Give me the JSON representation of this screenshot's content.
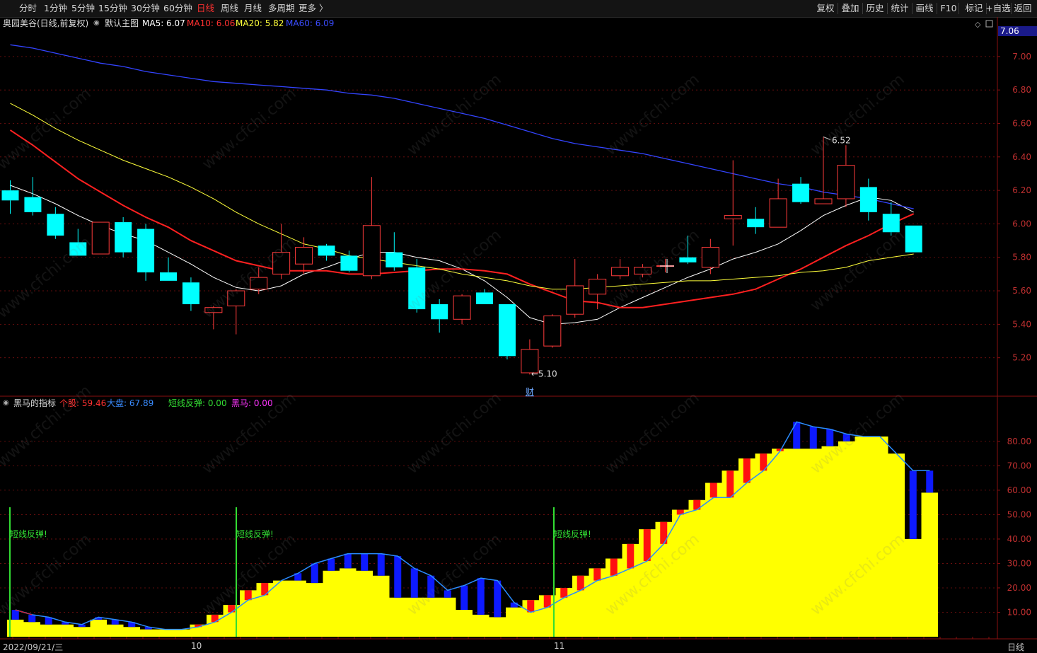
{
  "toolbar": {
    "periods": [
      {
        "label": "分时",
        "active": false
      },
      {
        "label": "1分钟",
        "active": false
      },
      {
        "label": "5分钟",
        "active": false
      },
      {
        "label": "15分钟",
        "active": false
      },
      {
        "label": "30分钟",
        "active": false
      },
      {
        "label": "60分钟",
        "active": false
      },
      {
        "label": "日线",
        "active": true
      },
      {
        "label": "周线",
        "active": false
      },
      {
        "label": "月线",
        "active": false
      },
      {
        "label": "多周期",
        "active": false
      },
      {
        "label": "更多 〉",
        "active": false
      }
    ],
    "actions": [
      "复权",
      "叠加",
      "历史",
      "统计",
      "画线",
      "F10",
      "标记",
      "+自选",
      "返回"
    ]
  },
  "main_header": {
    "stock": "奥园美谷(日线,前复权)",
    "template": "默认主图",
    "ma5": "MA5: 6.07",
    "ma10": "MA10: 6.06",
    "ma20": "MA20: 5.82",
    "ma60": "MA60: 6.09",
    "last_price": "7.06"
  },
  "sub_header": {
    "name": "黑马的指标",
    "individual": "个股: 59.46",
    "market": "大盘: 67.89",
    "rebound": "短线反弹: 0.00",
    "darkhorse": "黑马: 0.00"
  },
  "bottom_bar": {
    "dates": [
      "2022/09/21/三",
      "10",
      "11"
    ],
    "period": "日线"
  },
  "watermark": "www.cfchi.com",
  "colors": {
    "up": "#ff3b3b",
    "down": "#00ffff",
    "ma5": "#ffffff",
    "ma10": "#ff2020",
    "ma20": "#ffff3a",
    "ma60": "#3344ff",
    "grid": "#7a1010",
    "axis_text": "#c03030",
    "fill_yellow": "#ffff00",
    "bar_blue": "#0d1aff",
    "bar_red": "#ff1010",
    "rebound_green": "#33dd33",
    "line_blue": "#2a8cff"
  },
  "chart_data": [
    {
      "type": "candlestick",
      "title": "奥园美谷(日线,前复权)",
      "ylim": [
        5.0,
        7.16
      ],
      "y_ticks": [
        "7.00",
        "6.80",
        "6.60",
        "6.40",
        "6.20",
        "6.00",
        "5.80",
        "5.60",
        "5.40",
        "5.20"
      ],
      "annotations": [
        {
          "text": "6.52",
          "kind": "high",
          "index": 36
        },
        {
          "text": "5.10",
          "kind": "low",
          "index": 23
        },
        {
          "text": "财",
          "kind": "event",
          "index": 23
        }
      ],
      "candles": [
        {
          "o": 6.2,
          "h": 6.26,
          "l": 6.06,
          "c": 6.14
        },
        {
          "o": 6.16,
          "h": 6.28,
          "l": 6.05,
          "c": 6.07
        },
        {
          "o": 6.06,
          "h": 6.1,
          "l": 5.91,
          "c": 5.93
        },
        {
          "o": 5.89,
          "h": 5.97,
          "l": 5.81,
          "c": 5.81
        },
        {
          "o": 5.82,
          "h": 6.01,
          "l": 5.82,
          "c": 6.01
        },
        {
          "o": 6.01,
          "h": 6.04,
          "l": 5.8,
          "c": 5.83
        },
        {
          "o": 5.97,
          "h": 6.0,
          "l": 5.66,
          "c": 5.71
        },
        {
          "o": 5.71,
          "h": 5.8,
          "l": 5.66,
          "c": 5.66
        },
        {
          "o": 5.65,
          "h": 5.68,
          "l": 5.48,
          "c": 5.52
        },
        {
          "o": 5.47,
          "h": 5.51,
          "l": 5.37,
          "c": 5.5
        },
        {
          "o": 5.51,
          "h": 5.61,
          "l": 5.34,
          "c": 5.6
        },
        {
          "o": 5.61,
          "h": 5.74,
          "l": 5.58,
          "c": 5.68
        },
        {
          "o": 5.7,
          "h": 6.0,
          "l": 5.67,
          "c": 5.83
        },
        {
          "o": 5.76,
          "h": 5.92,
          "l": 5.7,
          "c": 5.86
        },
        {
          "o": 5.87,
          "h": 5.88,
          "l": 5.78,
          "c": 5.81
        },
        {
          "o": 5.81,
          "h": 5.84,
          "l": 5.71,
          "c": 5.72
        },
        {
          "o": 5.69,
          "h": 6.28,
          "l": 5.67,
          "c": 5.99
        },
        {
          "o": 5.83,
          "h": 5.95,
          "l": 5.72,
          "c": 5.74
        },
        {
          "o": 5.74,
          "h": 5.79,
          "l": 5.47,
          "c": 5.49
        },
        {
          "o": 5.52,
          "h": 5.55,
          "l": 5.35,
          "c": 5.43
        },
        {
          "o": 5.43,
          "h": 5.58,
          "l": 5.4,
          "c": 5.57
        },
        {
          "o": 5.59,
          "h": 5.61,
          "l": 5.52,
          "c": 5.52
        },
        {
          "o": 5.52,
          "h": 5.52,
          "l": 5.19,
          "c": 5.21
        },
        {
          "o": 5.11,
          "h": 5.31,
          "l": 5.1,
          "c": 5.25
        },
        {
          "o": 5.27,
          "h": 5.46,
          "l": 5.26,
          "c": 5.45
        },
        {
          "o": 5.46,
          "h": 5.79,
          "l": 5.44,
          "c": 5.63
        },
        {
          "o": 5.58,
          "h": 5.7,
          "l": 5.49,
          "c": 5.67
        },
        {
          "o": 5.69,
          "h": 5.79,
          "l": 5.67,
          "c": 5.74
        },
        {
          "o": 5.7,
          "h": 5.76,
          "l": 5.68,
          "c": 5.74
        },
        {
          "o": 5.75,
          "h": 5.79,
          "l": 5.71,
          "c": 5.75
        },
        {
          "o": 5.8,
          "h": 5.93,
          "l": 5.76,
          "c": 5.77
        },
        {
          "o": 5.74,
          "h": 5.91,
          "l": 5.7,
          "c": 5.86
        },
        {
          "o": 6.03,
          "h": 6.38,
          "l": 5.87,
          "c": 6.05
        },
        {
          "o": 6.03,
          "h": 6.1,
          "l": 5.94,
          "c": 5.98
        },
        {
          "o": 5.98,
          "h": 6.27,
          "l": 5.98,
          "c": 6.15
        },
        {
          "o": 6.24,
          "h": 6.28,
          "l": 6.12,
          "c": 6.13
        },
        {
          "o": 6.12,
          "h": 6.52,
          "l": 6.12,
          "c": 6.15
        },
        {
          "o": 6.15,
          "h": 6.47,
          "l": 6.1,
          "c": 6.35
        },
        {
          "o": 6.22,
          "h": 6.27,
          "l": 6.02,
          "c": 6.07
        },
        {
          "o": 6.06,
          "h": 6.13,
          "l": 5.93,
          "c": 5.95
        },
        {
          "o": 5.99,
          "h": 5.99,
          "l": 5.83,
          "c": 5.83
        }
      ],
      "series": [
        {
          "name": "MA5",
          "values": [
            6.23,
            6.18,
            6.12,
            6.05,
            5.99,
            5.94,
            5.9,
            5.83,
            5.76,
            5.68,
            5.62,
            5.6,
            5.63,
            5.7,
            5.74,
            5.79,
            5.83,
            5.83,
            5.8,
            5.78,
            5.73,
            5.66,
            5.56,
            5.44,
            5.4,
            5.41,
            5.43,
            5.5,
            5.56,
            5.62,
            5.68,
            5.73,
            5.79,
            5.83,
            5.88,
            5.96,
            6.05,
            6.11,
            6.16,
            6.14,
            6.07
          ]
        },
        {
          "name": "MA10",
          "values": [
            6.56,
            6.47,
            6.37,
            6.27,
            6.19,
            6.11,
            6.04,
            5.98,
            5.9,
            5.84,
            5.78,
            5.75,
            5.72,
            5.72,
            5.72,
            5.7,
            5.7,
            5.71,
            5.72,
            5.73,
            5.73,
            5.72,
            5.7,
            5.64,
            5.59,
            5.54,
            5.53,
            5.5,
            5.5,
            5.52,
            5.54,
            5.56,
            5.58,
            5.61,
            5.67,
            5.73,
            5.8,
            5.87,
            5.93,
            6.0,
            6.06
          ]
        },
        {
          "name": "MA20",
          "values": [
            6.72,
            6.65,
            6.57,
            6.5,
            6.44,
            6.38,
            6.33,
            6.28,
            6.22,
            6.15,
            6.07,
            6.0,
            5.94,
            5.88,
            5.85,
            5.81,
            5.79,
            5.77,
            5.75,
            5.73,
            5.7,
            5.68,
            5.66,
            5.63,
            5.61,
            5.61,
            5.62,
            5.63,
            5.64,
            5.65,
            5.66,
            5.66,
            5.67,
            5.68,
            5.69,
            5.71,
            5.72,
            5.74,
            5.78,
            5.8,
            5.82
          ]
        },
        {
          "name": "MA60",
          "values": [
            7.07,
            7.05,
            7.02,
            6.99,
            6.96,
            6.94,
            6.91,
            6.89,
            6.87,
            6.85,
            6.84,
            6.83,
            6.82,
            6.81,
            6.8,
            6.78,
            6.77,
            6.75,
            6.72,
            6.69,
            6.66,
            6.63,
            6.59,
            6.55,
            6.51,
            6.48,
            6.46,
            6.44,
            6.42,
            6.39,
            6.36,
            6.33,
            6.3,
            6.27,
            6.24,
            6.22,
            6.19,
            6.17,
            6.15,
            6.12,
            6.09
          ]
        }
      ]
    },
    {
      "type": "bar",
      "title": "黑马的指标",
      "ylim": [
        0,
        93
      ],
      "y_ticks": [
        "80.00",
        "70.00",
        "60.00",
        "50.00",
        "40.00",
        "30.00",
        "20.00",
        "10.00"
      ],
      "rebound_label": "短线反弹!",
      "rebound_index": [
        0,
        10,
        24
      ],
      "stock_values": [
        7,
        6,
        5,
        5,
        4,
        7,
        5,
        4,
        3,
        3,
        3,
        5,
        9,
        13,
        19,
        22,
        23,
        23,
        22,
        27,
        28,
        27,
        25,
        16,
        16,
        16,
        16,
        11,
        9,
        8,
        12,
        15,
        17,
        20,
        25,
        28,
        32,
        38,
        44,
        47,
        52,
        56,
        63,
        68,
        73,
        75,
        77,
        77,
        77,
        78,
        80,
        82,
        82,
        75,
        40,
        59
      ],
      "market_values": [
        11,
        9,
        8,
        6,
        5,
        8,
        7,
        6,
        4,
        3,
        3,
        4,
        6,
        10,
        15,
        17,
        23,
        26,
        30,
        32,
        34,
        34,
        34,
        33,
        28,
        25,
        19,
        21,
        24,
        23,
        14,
        10,
        12,
        16,
        19,
        23,
        25,
        28,
        31,
        38,
        50,
        52,
        57,
        57,
        63,
        68,
        76,
        88,
        86,
        85,
        83,
        82,
        82,
        75,
        68,
        68
      ]
    }
  ]
}
